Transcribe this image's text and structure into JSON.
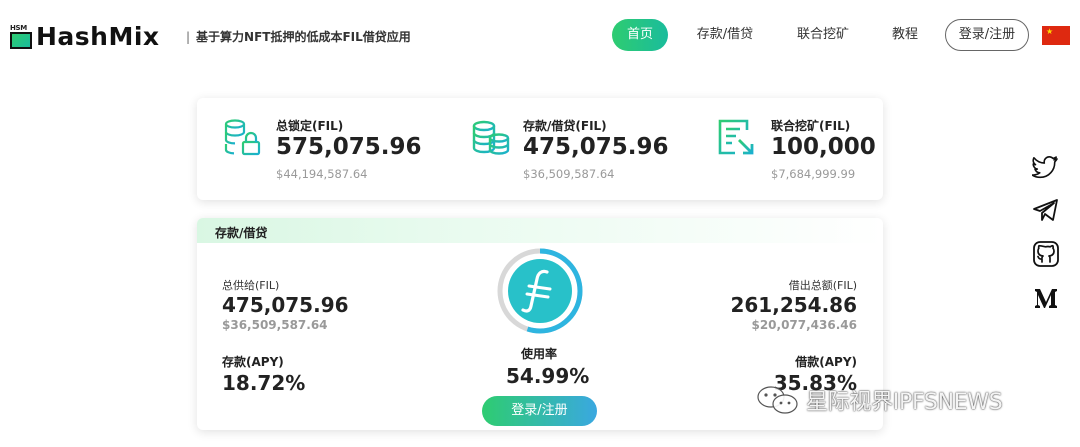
{
  "header": {
    "logo_badge": "HSM",
    "logo_text": "HashMix",
    "tagline_sep": "|",
    "tagline": "基于算力NFT抵押的低成本FIL借贷应用",
    "nav": {
      "home": "首页",
      "deposit": "存款/借贷",
      "mining": "联合挖矿",
      "tutorial": "教程",
      "login": "登录/注册"
    },
    "flag": "cn-flag"
  },
  "stats": [
    {
      "icon": "coins-lock-icon",
      "label": "总锁定(FIL)",
      "value": "575,075.96",
      "usd": "$44,194,587.64"
    },
    {
      "icon": "coin-stack-icon",
      "label": "存款/借贷(FIL)",
      "value": "475,075.96",
      "usd": "$36,509,587.64"
    },
    {
      "icon": "mining-export-icon",
      "label": "联合挖矿(FIL)",
      "value": "100,000",
      "usd": "$7,684,999.99"
    }
  ],
  "lend": {
    "title": "存款/借贷",
    "supply_label": "总供给(FIL)",
    "supply_value": "475,075.96",
    "supply_usd": "$36,509,587.64",
    "deposit_apy_label": "存款(APY)",
    "deposit_apy": "18.72%",
    "borrow_label": "借出总额(FIL)",
    "borrow_value": "261,254.86",
    "borrow_usd": "$20,077,436.46",
    "borrow_apy_label": "借款(APY)",
    "borrow_apy": "35.83%",
    "utilization_label": "使用率",
    "utilization": "54.99%",
    "utilization_fraction": 0.5499,
    "login_button": "登录/注册",
    "gauge_icon": "filecoin-icon"
  },
  "social": [
    "twitter-icon",
    "telegram-icon",
    "github-icon",
    "medium-icon"
  ],
  "watermark": "星际视界IPFSNEWS",
  "colors": {
    "accent_green": "#2ecc71",
    "accent_teal": "#1abc9c",
    "accent_blue": "#3aa8e0",
    "filecoin": "#28c1c9"
  }
}
